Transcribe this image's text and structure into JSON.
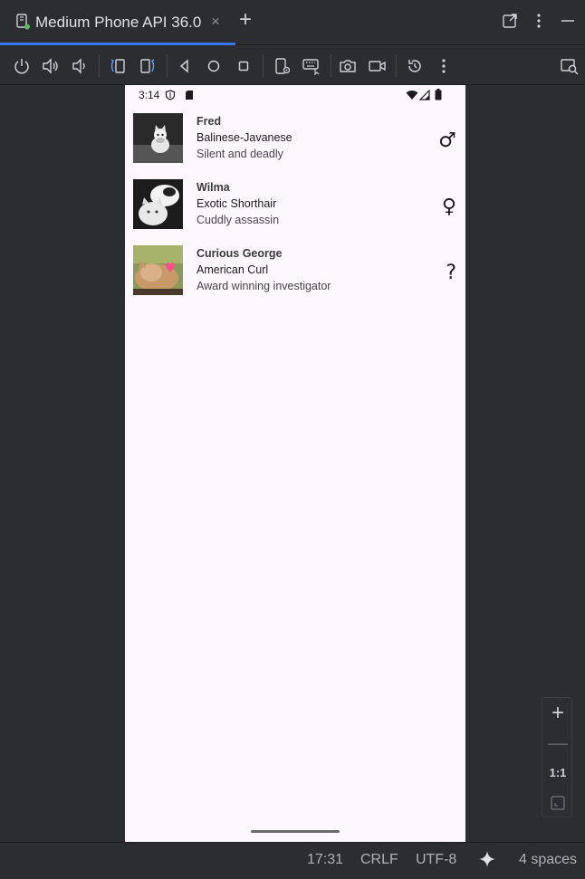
{
  "tab": {
    "title": "Medium Phone API 36.0",
    "close": "×",
    "add": "+"
  },
  "toolbar": {
    "icons": [
      "power-icon",
      "volume-up-icon",
      "volume-down-icon",
      "rotate-left-icon",
      "rotate-right-icon",
      "back-icon",
      "home-icon",
      "overview-icon",
      "device-settings-icon",
      "keyboard-icon",
      "camera-icon",
      "screen-record-icon",
      "snapshot-icon",
      "more-icon",
      "layout-inspector-icon"
    ]
  },
  "device": {
    "status": {
      "time": "3:14"
    },
    "cats": [
      {
        "name": "Fred",
        "breed": "Balinese-Javanese",
        "description": "Silent and deadly",
        "gender": "♂"
      },
      {
        "name": "Wilma",
        "breed": "Exotic Shorthair",
        "description": "Cuddly assassin",
        "gender": "♀"
      },
      {
        "name": "Curious George",
        "breed": "American Curl",
        "description": "Award winning investigator",
        "gender": "?"
      }
    ]
  },
  "zoom": {
    "plus": "+",
    "minus": "—",
    "one_to_one": "1:1"
  },
  "statusbar": {
    "position": "17:31",
    "line_endings": "CRLF",
    "encoding": "UTF-8",
    "indent": "4 spaces"
  },
  "colors": {
    "accent": "#3574f0",
    "phone_bg": "#fdf7fe",
    "ide_bg": "#2b2d30"
  }
}
